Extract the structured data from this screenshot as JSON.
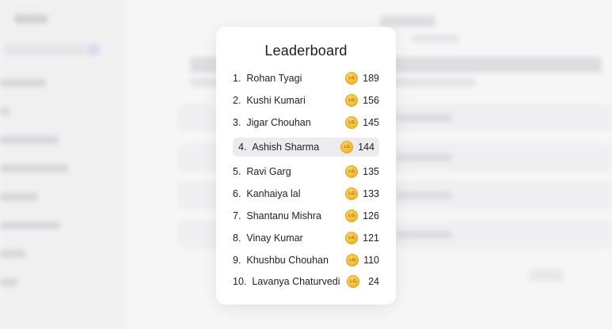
{
  "leaderboard": {
    "title": "Leaderboard",
    "coin_label": "LG",
    "entries": [
      {
        "rank": "1.",
        "name": "Rohan Tyagi",
        "score": "189"
      },
      {
        "rank": "2.",
        "name": "Kushi Kumari",
        "score": "156"
      },
      {
        "rank": "3.",
        "name": "Jigar Chouhan",
        "score": "145"
      },
      {
        "rank": "4.",
        "name": "Ashish Sharma",
        "score": "144",
        "highlighted": true
      },
      {
        "rank": "5.",
        "name": "Ravi Garg",
        "score": "135"
      },
      {
        "rank": "6.",
        "name": "Kanhaiya lal",
        "score": "133"
      },
      {
        "rank": "7.",
        "name": "Shantanu Mishra",
        "score": "126"
      },
      {
        "rank": "8.",
        "name": "Vinay Kumar",
        "score": "121"
      },
      {
        "rank": "9.",
        "name": "Khushbu Chouhan",
        "score": "110"
      },
      {
        "rank": "10.",
        "name": "Lavanya Chaturvedi",
        "score": "24"
      }
    ]
  },
  "colors": {
    "highlight_row": "#ececee",
    "coin": "#f2b72a"
  }
}
